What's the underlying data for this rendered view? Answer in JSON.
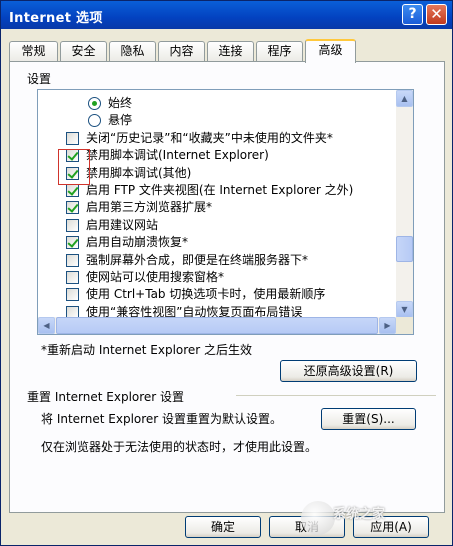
{
  "window": {
    "title": "Internet 选项"
  },
  "titlebar": {
    "help_glyph": "?",
    "close_glyph": "✕"
  },
  "tabs": [
    {
      "label": "常规"
    },
    {
      "label": "安全"
    },
    {
      "label": "隐私"
    },
    {
      "label": "内容"
    },
    {
      "label": "连接"
    },
    {
      "label": "程序"
    },
    {
      "label": "高级",
      "active": true
    }
  ],
  "settings": {
    "group_label": "设置",
    "items": [
      {
        "type": "radio",
        "checked": true,
        "label": "始终"
      },
      {
        "type": "radio",
        "checked": false,
        "label": "悬停"
      },
      {
        "type": "checkbox",
        "checked": false,
        "label": "关闭“历史记录”和“收藏夹”中未使用的文件夹*"
      },
      {
        "type": "checkbox",
        "checked": true,
        "label": "禁用脚本调试(Internet Explorer)"
      },
      {
        "type": "checkbox",
        "checked": true,
        "label": "禁用脚本调试(其他)"
      },
      {
        "type": "checkbox",
        "checked": true,
        "label": "启用 FTP 文件夹视图(在 Internet Explorer 之外)"
      },
      {
        "type": "checkbox",
        "checked": true,
        "label": "启用第三方浏览器扩展*"
      },
      {
        "type": "checkbox",
        "checked": false,
        "label": "启用建议网站"
      },
      {
        "type": "checkbox",
        "checked": true,
        "label": "启用自动崩溃恢复*"
      },
      {
        "type": "checkbox",
        "checked": false,
        "label": "强制屏幕外合成，即便是在终端服务器下*"
      },
      {
        "type": "checkbox",
        "checked": false,
        "label": "使网站可以使用搜索窗格*"
      },
      {
        "type": "checkbox",
        "checked": false,
        "label": "使用 Ctrl+Tab 切换选项卡时，使用最新顺序"
      },
      {
        "type": "checkbox",
        "checked": false,
        "label": "使用“兼容性视图”自动恢复页面布局错误"
      }
    ],
    "restart_note": "*重新启动 Internet Explorer 之后生效",
    "restore_button": "还原高级设置(R)"
  },
  "reset": {
    "title": "重置 Internet Explorer 设置",
    "description": "将 Internet Explorer 设置重置为默认设置。",
    "button": "重置(S)...",
    "usage_note": "仅在浏览器处于无法使用的状态时，才使用此设置。"
  },
  "footer": {
    "ok": "确定",
    "cancel": "取消",
    "apply": "应用(A)"
  },
  "watermark": {
    "text": "系统之家"
  }
}
